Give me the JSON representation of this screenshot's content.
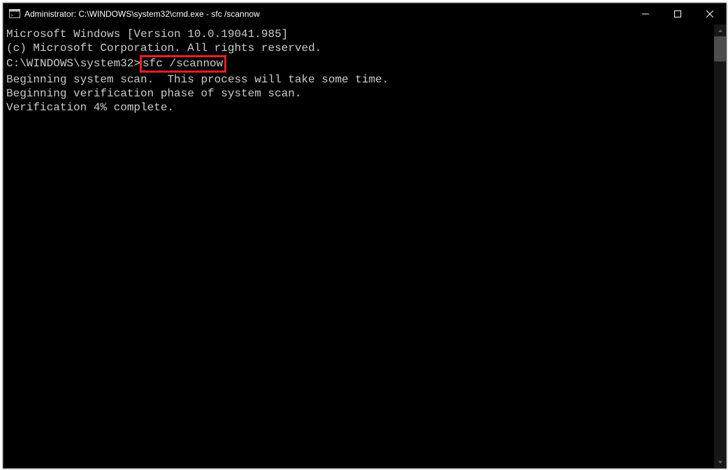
{
  "window": {
    "title": "Administrator: C:\\WINDOWS\\system32\\cmd.exe - sfc  /scannow"
  },
  "console": {
    "line1": "Microsoft Windows [Version 10.0.19041.985]",
    "line2": "(c) Microsoft Corporation. All rights reserved.",
    "blank1": "",
    "prompt": "C:\\WINDOWS\\system32>",
    "command": "sfc /scannow",
    "blank2": "",
    "line3": "Beginning system scan.  This process will take some time.",
    "blank3": "",
    "line4": "Beginning verification phase of system scan.",
    "line5": "Verification 4% complete."
  }
}
